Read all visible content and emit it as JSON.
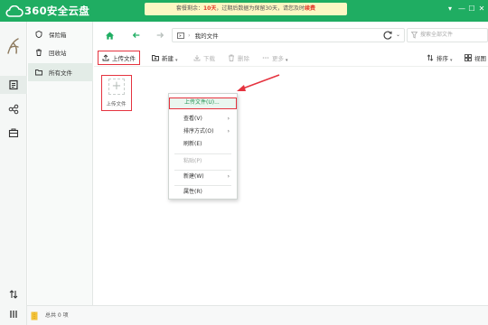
{
  "app": {
    "name": "360安全云盘"
  },
  "notice": {
    "prefix": "套餐剩余：",
    "days": "10天",
    "middle": "，过期后数据为保留30天，请您及时",
    "action": "续费"
  },
  "window_controls": [
    "▾",
    "—",
    "☐",
    "✕"
  ],
  "rail": {
    "items": [
      "avatar",
      "files-icon",
      "share-icon",
      "toolbox-icon",
      "transfer-icon",
      "menu-icon"
    ]
  },
  "sidebar": {
    "items": [
      {
        "label": "保险箱",
        "icon": "safe-icon"
      },
      {
        "label": "回收站",
        "icon": "trash-icon"
      },
      {
        "label": "所有文件",
        "icon": "folder-icon",
        "active": true
      }
    ]
  },
  "address": {
    "path_root": "我的文件",
    "search_placeholder": "搜索全部文件"
  },
  "toolbar": {
    "upload": "上传文件",
    "new": "新建",
    "download": "下载",
    "delete": "删除",
    "more": "更多",
    "sort": "排序",
    "view": "视图"
  },
  "content": {
    "upload_tile_label": "上传文件"
  },
  "context_menu": {
    "items": [
      {
        "label": "上传文件(U)...",
        "state": "hover"
      },
      {
        "label": "查看(V)",
        "submenu": true
      },
      {
        "label": "排序方式(O)",
        "submenu": true
      },
      {
        "label": "刷新(E)"
      },
      {
        "label": "粘贴(P)",
        "state": "disabled"
      },
      {
        "label": "新建(W)",
        "submenu": true
      },
      {
        "label": "属性(R)"
      }
    ]
  },
  "status": {
    "text": "总共 0 项"
  },
  "colors": {
    "brand": "#1fad62",
    "annotation": "#e5333f",
    "notice_bg": "#fdf7c3"
  }
}
